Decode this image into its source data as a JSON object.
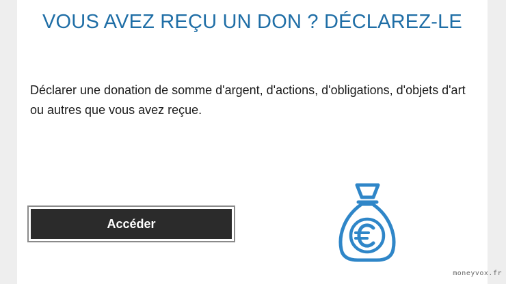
{
  "card": {
    "title": "VOUS AVEZ REÇU UN DON ? DÉCLAREZ-LE",
    "description": "Déclarer une donation de somme d'argent, d'actions, d'obligations, d'objets d'art ou autres que vous avez reçue.",
    "button_label": "Accéder",
    "icon": "money-bag-euro-icon"
  },
  "watermark": "moneyvox.fr",
  "colors": {
    "title": "#1f6ea6",
    "icon": "#2f86c8",
    "button_bg": "#2b2b2b",
    "button_text": "#ffffff"
  }
}
